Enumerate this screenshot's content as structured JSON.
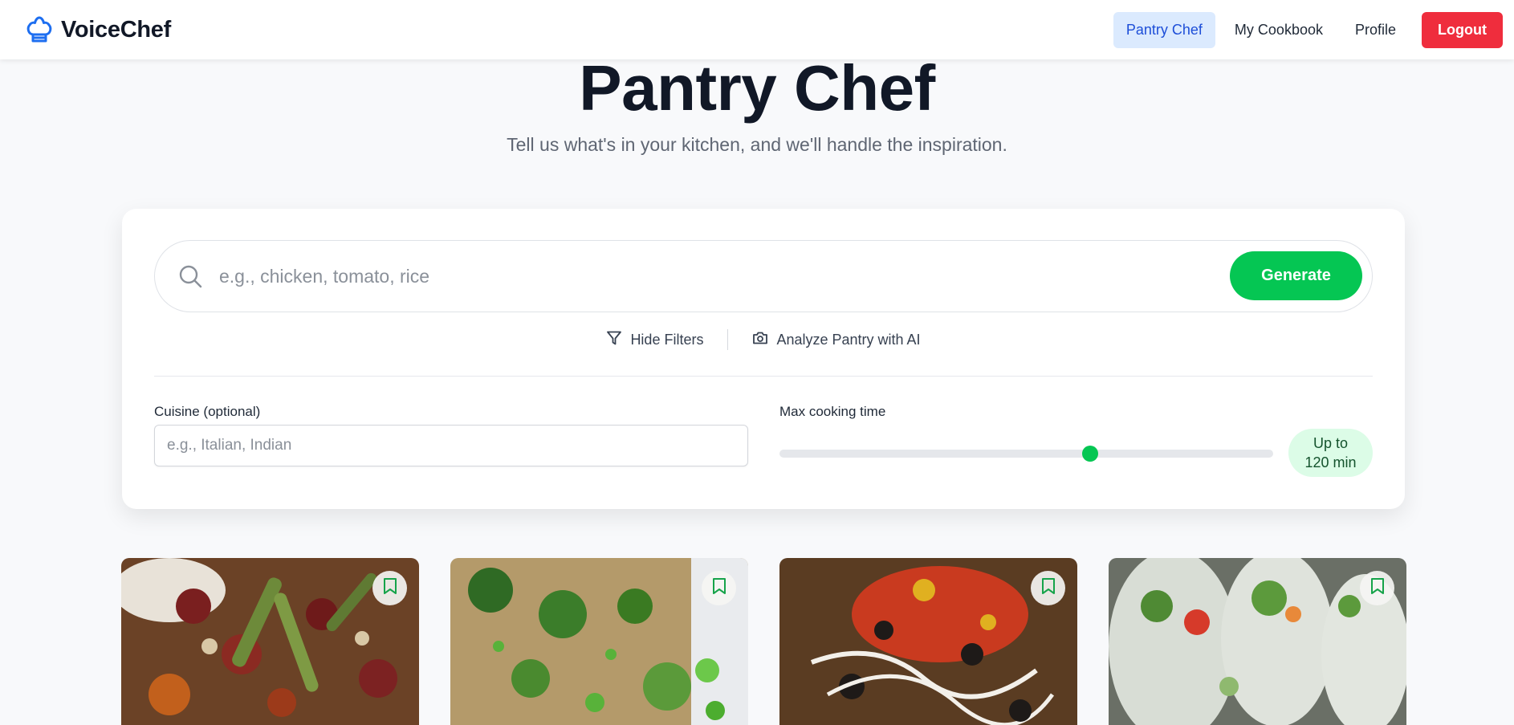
{
  "app": {
    "name": "VoiceChef",
    "icon": "chef-hat-icon",
    "accent": "#2563eb"
  },
  "nav": {
    "items": [
      {
        "label": "Pantry Chef",
        "active": true
      },
      {
        "label": "My Cookbook",
        "active": false
      },
      {
        "label": "Profile",
        "active": false
      }
    ],
    "logout_label": "Logout"
  },
  "hero": {
    "title": "Pantry Chef",
    "subtitle": "Tell us what's in your kitchen, and we'll handle the inspiration."
  },
  "search": {
    "icon": "search-icon",
    "placeholder": "e.g., chicken, tomato, rice",
    "value": "",
    "generate_label": "Generate"
  },
  "actions": {
    "hide_filters": {
      "label": "Hide Filters",
      "icon": "filter-icon"
    },
    "analyze_pantry": {
      "label": "Analyze Pantry with AI",
      "icon": "camera-icon"
    }
  },
  "filters": {
    "cuisine": {
      "label": "Cuisine (optional)",
      "placeholder": "e.g., Italian, Indian",
      "value": ""
    },
    "max_time": {
      "label": "Max cooking time",
      "value_fraction": 0.63,
      "badge_line1": "Up to",
      "badge_line2": "120 min"
    }
  },
  "recipes": [
    {
      "bookmark_icon": "bookmark-icon"
    },
    {
      "bookmark_icon": "bookmark-icon"
    },
    {
      "bookmark_icon": "bookmark-icon"
    },
    {
      "bookmark_icon": "bookmark-icon"
    }
  ],
  "colors": {
    "primary_green": "#05c653",
    "logout_red": "#ef2d3d",
    "active_nav_bg": "#dbeafe",
    "badge_bg": "#dcfce7"
  }
}
